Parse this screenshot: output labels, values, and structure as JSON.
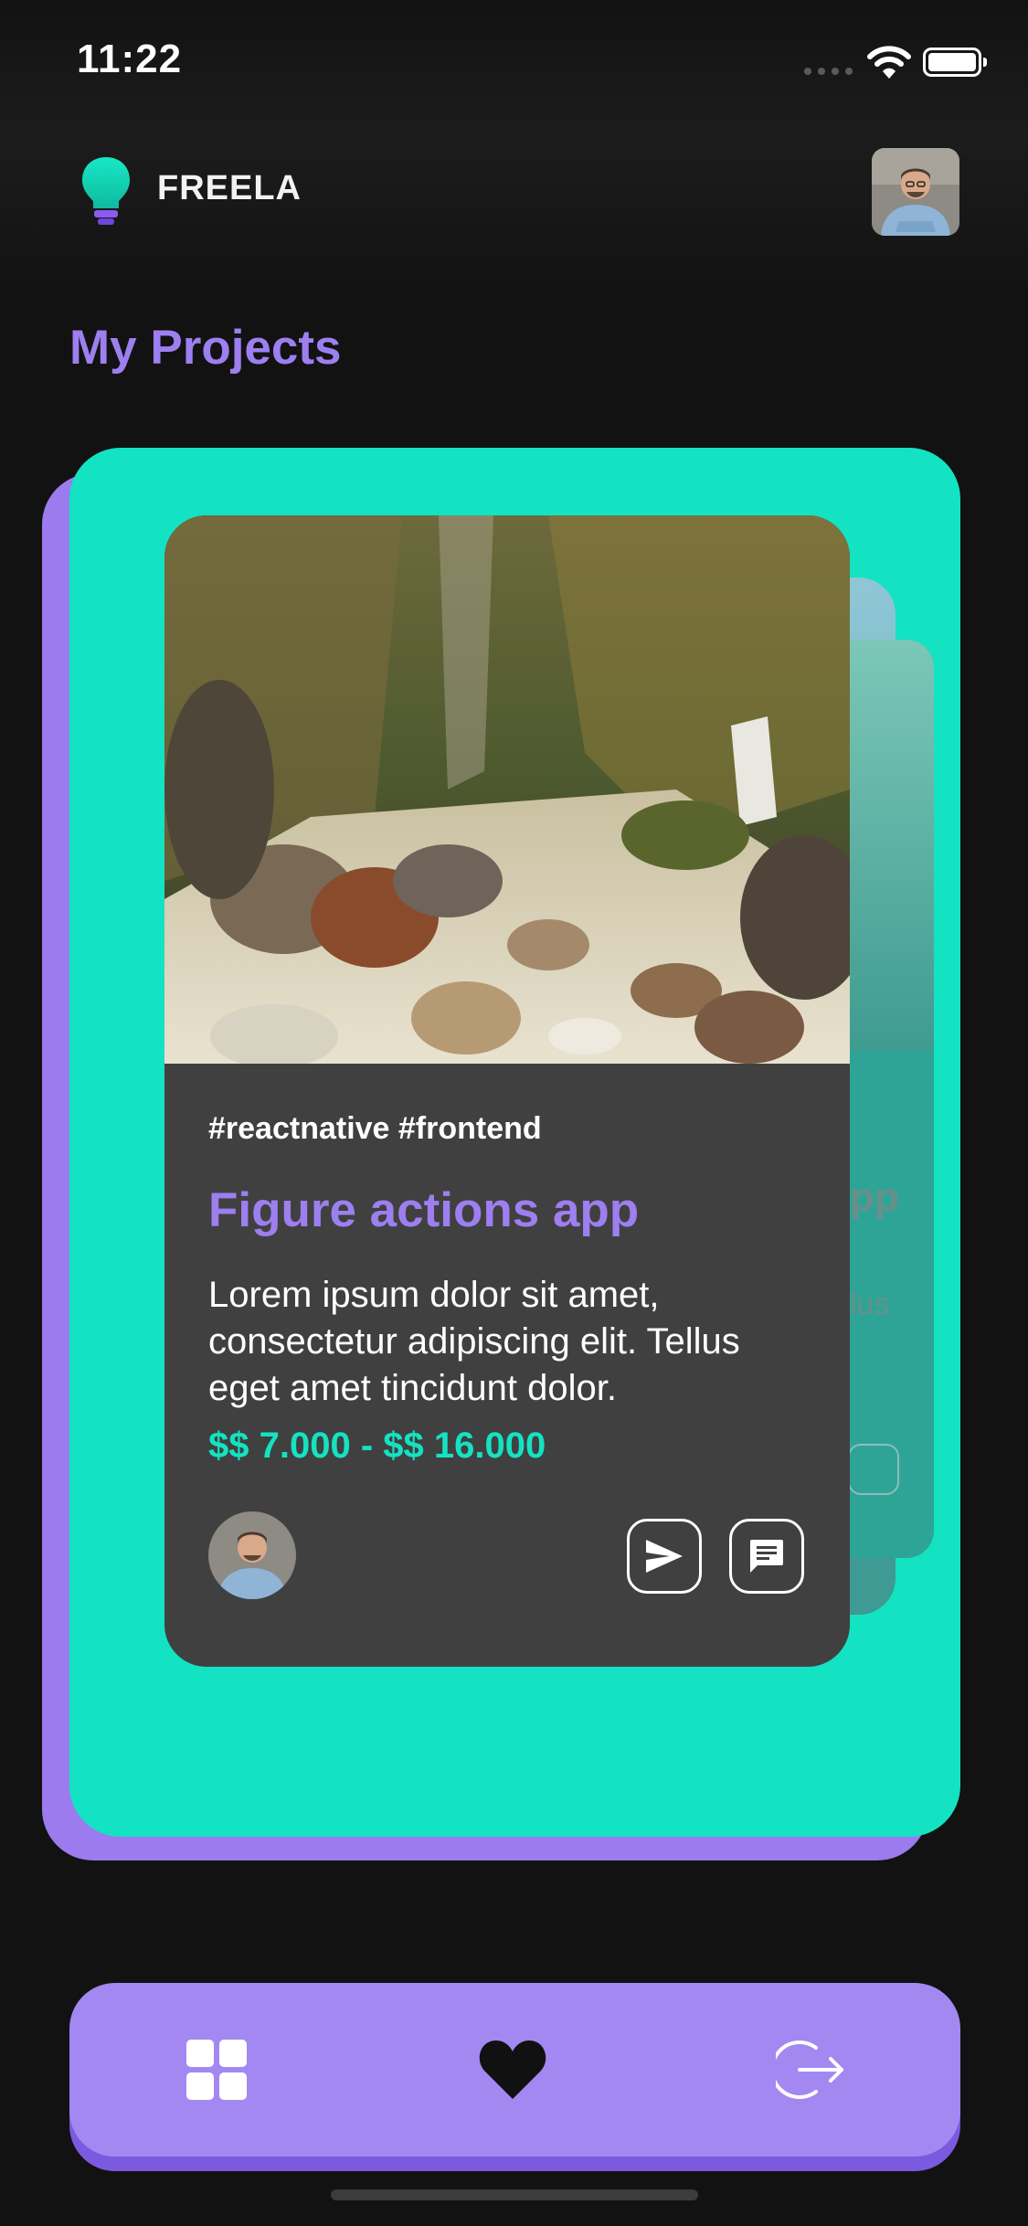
{
  "status_bar": {
    "time": "11:22"
  },
  "header": {
    "brand": "FREELA"
  },
  "page": {
    "title": "My Projects"
  },
  "project_card": {
    "tags": "#reactnative #frontend",
    "title": "Figure actions app",
    "description": "Lorem ipsum dolor sit amet, consectetur adipiscing elit. Tellus eget amet tincidunt dolor.",
    "price": "$$ 7.000 - $$ 16.000"
  },
  "background_cards": {
    "title_fragment": "pp",
    "desc_fragment": "lus"
  },
  "icons": {
    "send": "send-icon",
    "chat": "chat-icon",
    "grid": "grid-icon",
    "heart": "heart-icon",
    "logout": "logout-icon"
  },
  "colors": {
    "background": "#121212",
    "accent_purple": "#9d7ff0",
    "accent_teal": "#13e3c2",
    "card": "#404040",
    "tabbar": "#a388f2"
  }
}
